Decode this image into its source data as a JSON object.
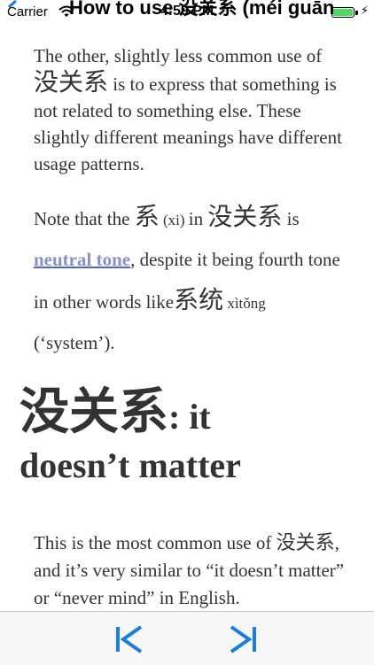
{
  "status_bar": {
    "carrier": "Carrier",
    "time": "4:59 PM",
    "battery_color": "#4cd964"
  },
  "nav": {
    "title": "How to use 没关系 (méi guān..."
  },
  "content": {
    "p1": {
      "t1": "The other, slightly less common use of ",
      "zh1": "没关系",
      "t2": " is to express that something is not related to something else. These slightly different meanings have different usage patterns."
    },
    "p2": {
      "t1": "Note that the ",
      "zh1": "系",
      "pinyin1": " (xi) ",
      "t2": "in ",
      "zh2": "没关系",
      "t3": " is ",
      "link": "neutral tone",
      "t4": ", despite it being fourth tone in other words like",
      "zh3": "系统",
      "pinyin2": " xìtǒng",
      "t5": " (‘system’)."
    },
    "heading": {
      "zh": "没关系",
      "en1": ": it",
      "en2": "doesn’t matter"
    },
    "p3": {
      "t1": "This is the most common use of ",
      "zh1": "没关系",
      "t2": ", and it’s very similar to “it doesn’t matter” or “never mind” in English."
    }
  },
  "toolbar": {
    "accent": "#1a7de0",
    "prev_icon": "skip-back-icon",
    "next_icon": "skip-forward-icon"
  }
}
